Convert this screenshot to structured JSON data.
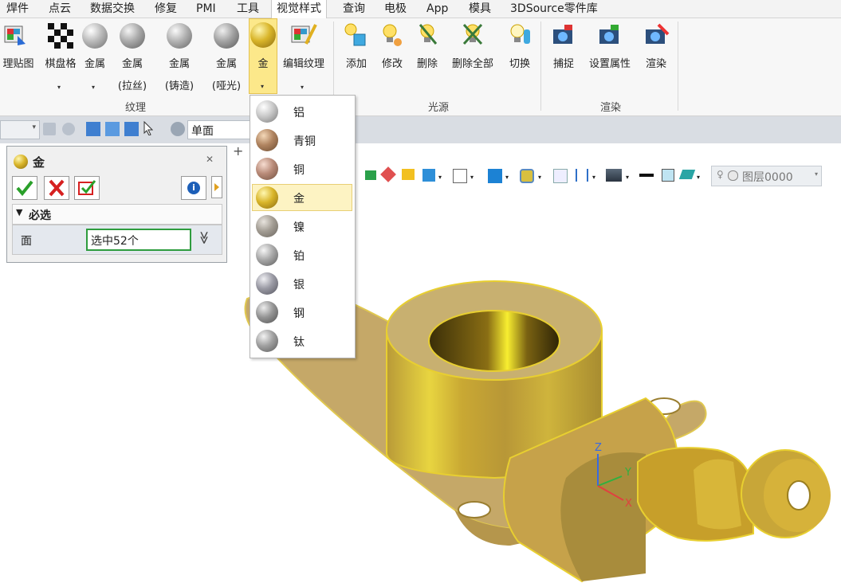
{
  "menubar": {
    "items": [
      "焊件",
      "点云",
      "数据交换",
      "修复",
      "PMI",
      "工具",
      "视觉样式",
      "查询",
      "电极",
      "App",
      "模具",
      "3DSource零件库"
    ],
    "active": "视觉样式"
  },
  "ribbon": {
    "texture_group_label": "纹理",
    "light_group_label": "光源",
    "render_group_label": "渲染",
    "buttons": {
      "texture_map": "理贴图",
      "checker": "棋盘格",
      "metal": "金属",
      "metal_brushed_1": "金属",
      "metal_brushed_2": "(拉丝)",
      "metal_cast_1": "金属",
      "metal_cast_2": "(铸造)",
      "metal_matte_1": "金属",
      "metal_matte_2": "(哑光)",
      "gold": "金",
      "edit_texture": "编辑纹理",
      "add": "添加",
      "modify": "修改",
      "delete": "删除",
      "delete_all": "删除全部",
      "switch": "切换",
      "capture": "捕捉",
      "set_props": "设置属性",
      "render": "渲染"
    }
  },
  "toolbar2": {
    "filter_value": "单面"
  },
  "viewbar": {
    "layer_value": "图层0000",
    "tab_plus": "+"
  },
  "panel": {
    "title": "金",
    "close_glyph": "✕",
    "section_title": "必选",
    "field_label": "面",
    "field_value": "选中52个",
    "expand_glyph": "≫",
    "info_glyph": "i"
  },
  "dropdown": {
    "items": [
      "铝",
      "青铜",
      "铜",
      "金",
      "镍",
      "铂",
      "银",
      "钢",
      "钛"
    ],
    "selected": "金"
  },
  "axes": {
    "x": "X",
    "y": "Y",
    "z": "Z"
  },
  "colors": {
    "gold": "#c8a72c",
    "gold_highlight": "#f5e600",
    "dropdown_selected": "#fdf3c3",
    "accent_border": "#2e9c3e"
  }
}
